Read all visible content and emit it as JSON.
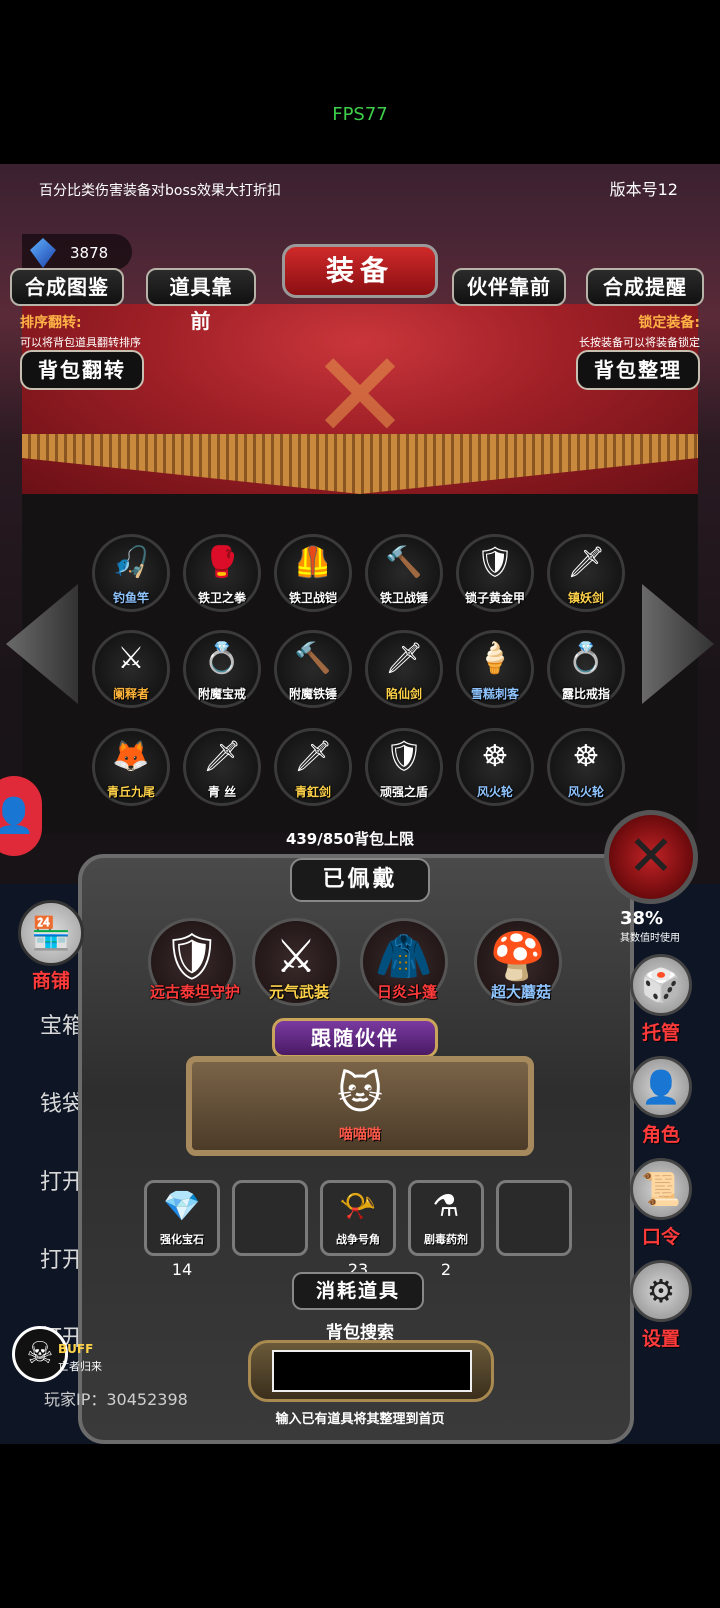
{
  "fps": "FPS77",
  "notice": "百分比类伤害装备对boss效果大打折扣",
  "version": "版本号12",
  "currency": {
    "icon": "blue-gem-icon",
    "value": "3878"
  },
  "top_nav": {
    "synth_atlas": "合成图鉴",
    "items_front": "道具靠前",
    "title": "装备",
    "partner_front": "伙伴靠前",
    "synth_remind": "合成提醒"
  },
  "hints": {
    "sort_title": "排序翻转:",
    "sort_text": "可以将背包道具翻转排序",
    "lock_title": "锁定装备:",
    "lock_text": "长按装备可以将装备锁定"
  },
  "bag_buttons": {
    "flip": "背包翻转",
    "tidy": "背包整理"
  },
  "bag_items": [
    {
      "label": "钓鱼竿",
      "icon": "fishing-rod-icon",
      "glyph": "🎣",
      "color": "blue"
    },
    {
      "label": "铁卫之拳",
      "icon": "iron-gauntlet-icon",
      "glyph": "🥊",
      "color": "white"
    },
    {
      "label": "铁卫战铠",
      "icon": "iron-armor-icon",
      "glyph": "🦺",
      "color": "white"
    },
    {
      "label": "铁卫战锤",
      "icon": "mace-icon",
      "glyph": "🔨",
      "color": "white"
    },
    {
      "label": "锁子黄金甲",
      "icon": "golden-armor-icon",
      "glyph": "🛡",
      "color": "white"
    },
    {
      "label": "镇妖剑",
      "icon": "ice-sword-icon",
      "glyph": "🗡",
      "color": "yellow"
    },
    {
      "label": "阑释者",
      "icon": "dark-sword-icon",
      "glyph": "⚔",
      "color": "orange"
    },
    {
      "label": "附魔宝戒",
      "icon": "enchanted-ring-icon",
      "glyph": "💍",
      "color": "white"
    },
    {
      "label": "附魔铁锤",
      "icon": "enchanted-hammer-icon",
      "glyph": "🔨",
      "color": "white"
    },
    {
      "label": "陷仙剑",
      "icon": "crystal-sword-icon",
      "glyph": "🗡",
      "color": "yellow"
    },
    {
      "label": "雪糕刺客",
      "icon": "ice-cream-dagger-icon",
      "glyph": "🍦",
      "color": "blue"
    },
    {
      "label": "露比戒指",
      "icon": "silver-ring-icon",
      "glyph": "💍",
      "color": "white"
    },
    {
      "label": "青丘九尾",
      "icon": "nine-tail-fox-icon",
      "glyph": "🦊",
      "color": "yellow"
    },
    {
      "label": "青 丝",
      "icon": "short-sword-icon",
      "glyph": "🗡",
      "color": "white"
    },
    {
      "label": "青釭剑",
      "icon": "blue-sword-icon",
      "glyph": "🗡",
      "color": "yellow"
    },
    {
      "label": "顽强之盾",
      "icon": "red-shield-icon",
      "glyph": "🛡",
      "color": "white"
    },
    {
      "label": "风火轮",
      "icon": "fire-wheel-icon",
      "glyph": "☸",
      "color": "blue"
    },
    {
      "label": "风火轮",
      "icon": "fire-wheel-icon",
      "glyph": "☸",
      "color": "blue"
    }
  ],
  "bag_count": "439/850背包上限",
  "worn": {
    "title": "已佩戴",
    "items": [
      {
        "label": "远古泰坦守护",
        "icon": "titan-armor-icon",
        "glyph": "🛡",
        "color": "#ff3a3a"
      },
      {
        "label": "元气武装",
        "icon": "vitality-armor-icon",
        "glyph": "⚔",
        "color": "#ffd24a"
      },
      {
        "label": "日炎斗篷",
        "icon": "sun-cloak-icon",
        "glyph": "🧥",
        "color": "#ff3a3a"
      },
      {
        "label": "超大蘑菇",
        "icon": "giant-mushroom-icon",
        "glyph": "🍄",
        "color": "#8fc4ff"
      }
    ]
  },
  "follow": {
    "title": "跟随伙伴",
    "companion": "喵喵喵",
    "companion_icon": "cat-warrior-icon"
  },
  "consumables": [
    {
      "label": "强化宝石",
      "icon": "green-gem-icon",
      "glyph": "💎",
      "count": "14"
    },
    {
      "label": "",
      "icon": "empty-slot",
      "glyph": "",
      "count": ""
    },
    {
      "label": "战争号角",
      "icon": "war-horn-icon",
      "glyph": "📯",
      "count": "23"
    },
    {
      "label": "剧毒药剂",
      "icon": "poison-potion-icon",
      "glyph": "⚗",
      "count": "2"
    },
    {
      "label": "",
      "icon": "empty-slot",
      "glyph": "",
      "count": ""
    }
  ],
  "consume_title": "消耗道具",
  "search": {
    "title": "背包搜索",
    "value": "",
    "hint": "输入已有道具将其整理到首页"
  },
  "side": {
    "shop": "商铺",
    "rate_pct": "38%",
    "rate_label": "其数值时使用",
    "manage": "托管",
    "role": "角色",
    "code": "口令",
    "settings": "设置"
  },
  "chat": [
    "宝箱",
    "钱袋子",
    "打开",
    "打开",
    "打开了精致的宝箱"
  ],
  "buff": {
    "label": "BUFF",
    "sub": "亡者归来"
  },
  "player_ip": "玩家IP：30452398"
}
